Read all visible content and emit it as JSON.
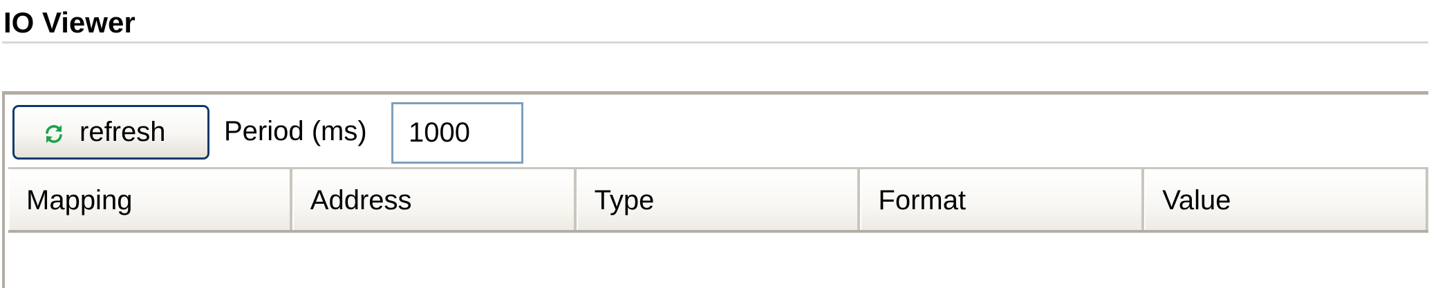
{
  "page": {
    "title": "IO Viewer"
  },
  "toolbar": {
    "refresh_icon": "refresh-icon",
    "refresh_label": "refresh",
    "period_label": "Period (ms)",
    "period_value": "1000"
  },
  "table": {
    "columns": [
      "Mapping",
      "Address",
      "Type",
      "Format",
      "Value"
    ],
    "rows": []
  },
  "colors": {
    "button_border": "#0e3a6c",
    "refresh_icon": "#1aa34a",
    "input_border": "#7c9fbd",
    "panel_border": "#b1ada4"
  }
}
